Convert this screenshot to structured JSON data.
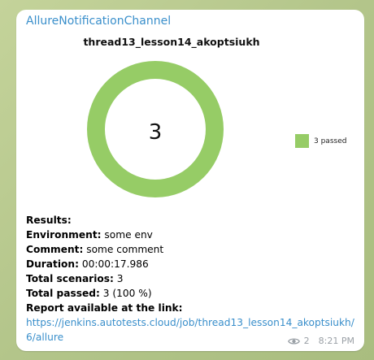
{
  "channel": {
    "name": "AllureNotificationChannel"
  },
  "chart_data": {
    "type": "pie",
    "title": "thread13_lesson14_akoptsiukh",
    "center_label": "3",
    "slices": [
      {
        "label": "3 passed",
        "value": 3,
        "color": "#96cc66"
      }
    ]
  },
  "results": {
    "heading": "Results:",
    "environment_label": "Environment:",
    "environment_value": " some env",
    "comment_label": "Comment:",
    "comment_value": " some comment",
    "duration_label": "Duration:",
    "duration_value": " 00:00:17.986",
    "total_scenarios_label": "Total scenarios:",
    "total_scenarios_value": " 3",
    "total_passed_label": "Total passed:",
    "total_passed_value": " 3 (100 %)",
    "report_label": "Report available at the link:",
    "report_link": "https://jenkins.autotests.cloud/job/thread13_lesson14_akoptsiukh/6/allure"
  },
  "meta": {
    "views": "2",
    "time": "8:21 PM",
    "view_icon": "eye-icon"
  }
}
